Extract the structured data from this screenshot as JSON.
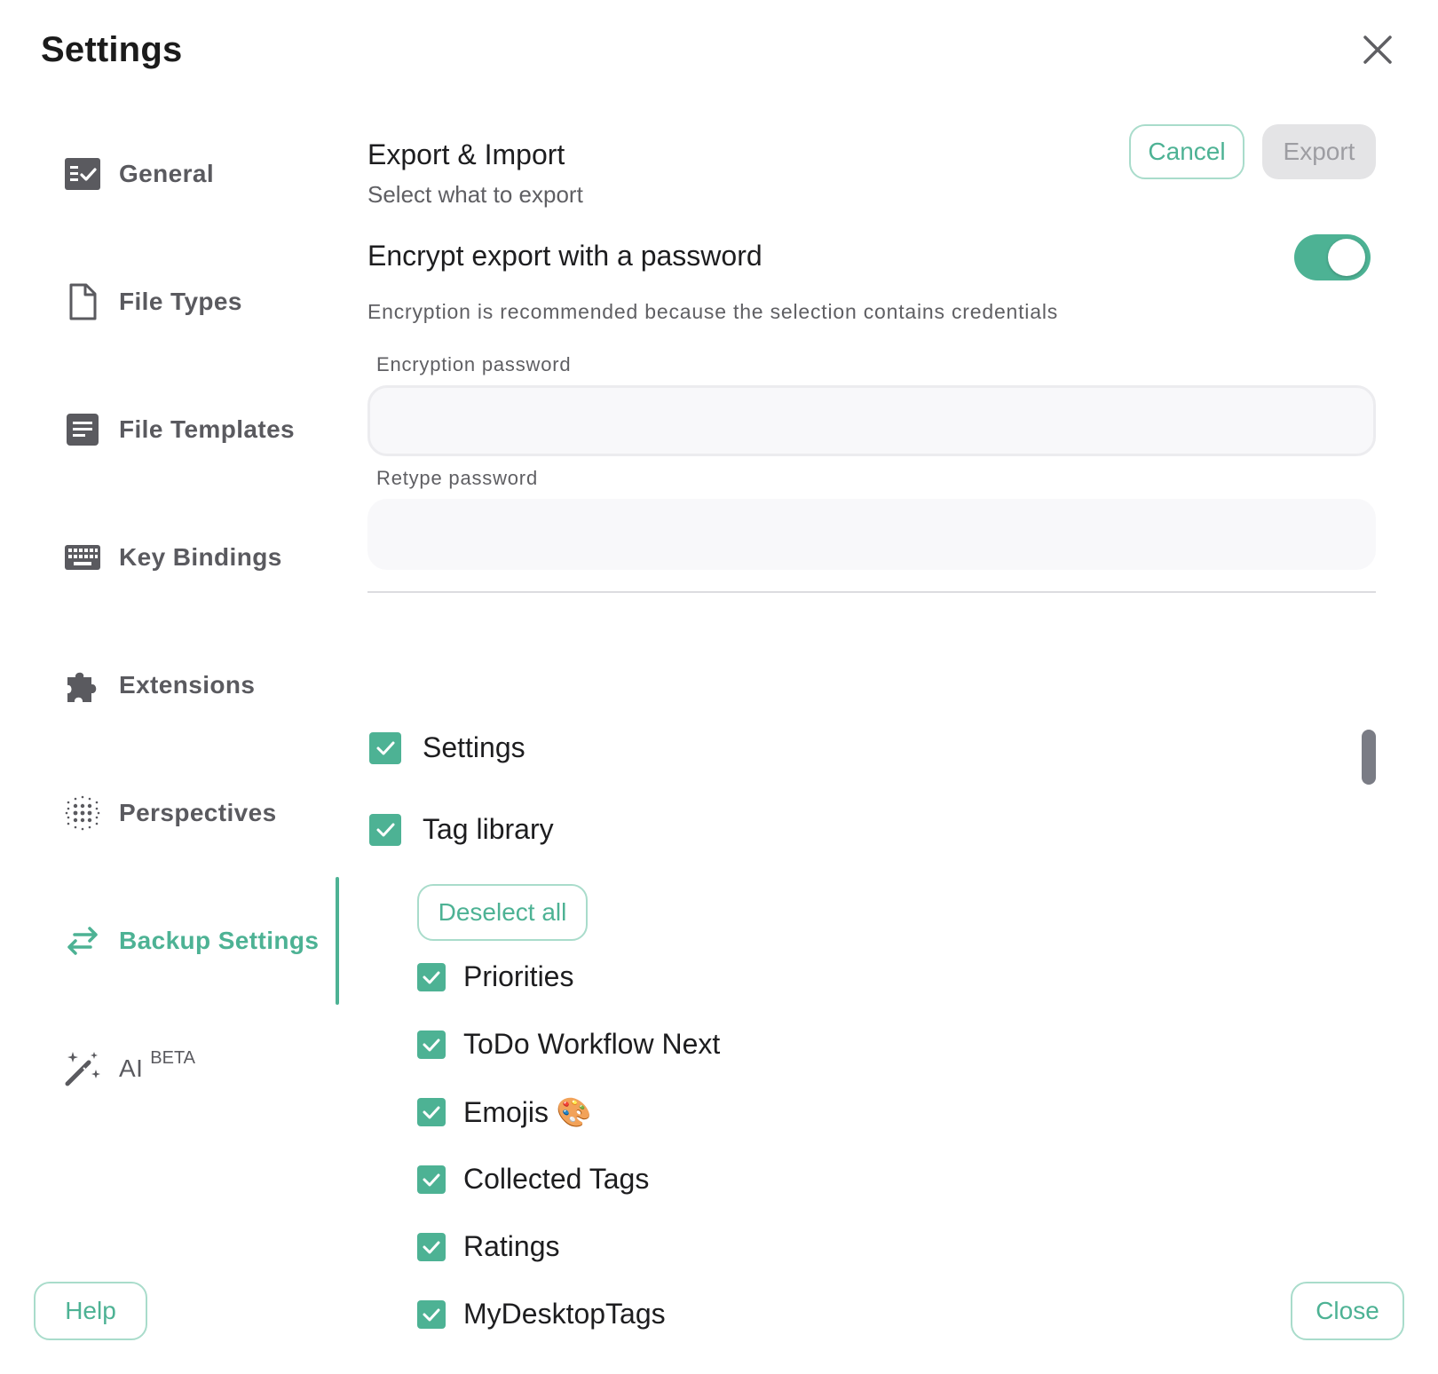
{
  "dialog": {
    "title": "Settings"
  },
  "sidebar": {
    "items": [
      {
        "label": "General",
        "icon": "checklist-icon"
      },
      {
        "label": "File Types",
        "icon": "file-icon"
      },
      {
        "label": "File Templates",
        "icon": "document-icon"
      },
      {
        "label": "Key Bindings",
        "icon": "keyboard-icon"
      },
      {
        "label": "Extensions",
        "icon": "puzzle-icon"
      },
      {
        "label": "Perspectives",
        "icon": "dots-grid-icon"
      },
      {
        "label": "Backup Settings",
        "icon": "swap-arrows-icon",
        "active": true
      },
      {
        "label": "AI",
        "icon": "magic-wand-icon",
        "badge": "BETA"
      }
    ]
  },
  "main": {
    "title": "Export & Import",
    "subtitle": "Select what to export",
    "cancel_label": "Cancel",
    "export_label": "Export",
    "encrypt_label": "Encrypt export with a password",
    "encrypt_enabled": true,
    "encrypt_note": "Encryption is recommended because the selection contains credentials",
    "password_label": "Encryption password",
    "password_value": "",
    "retype_label": "Retype password",
    "retype_value": ""
  },
  "export_list": {
    "top_items": [
      {
        "label": "Settings",
        "checked": true
      },
      {
        "label": "Tag library",
        "checked": true
      }
    ],
    "deselect_label": "Deselect all",
    "tag_groups": [
      {
        "label": "Priorities",
        "checked": true
      },
      {
        "label": "ToDo Workflow Next",
        "checked": true
      },
      {
        "label": "Emojis 🎨",
        "checked": true
      },
      {
        "label": "Collected Tags",
        "checked": true
      },
      {
        "label": "Ratings",
        "checked": true
      },
      {
        "label": "MyDesktopTags",
        "checked": true
      }
    ]
  },
  "footer": {
    "help_label": "Help",
    "close_label": "Close"
  },
  "colors": {
    "accent": "#4db294",
    "accent_border": "#a9dccb",
    "muted_text": "#5a5a5f",
    "disabled_bg": "#e4e4e6"
  }
}
